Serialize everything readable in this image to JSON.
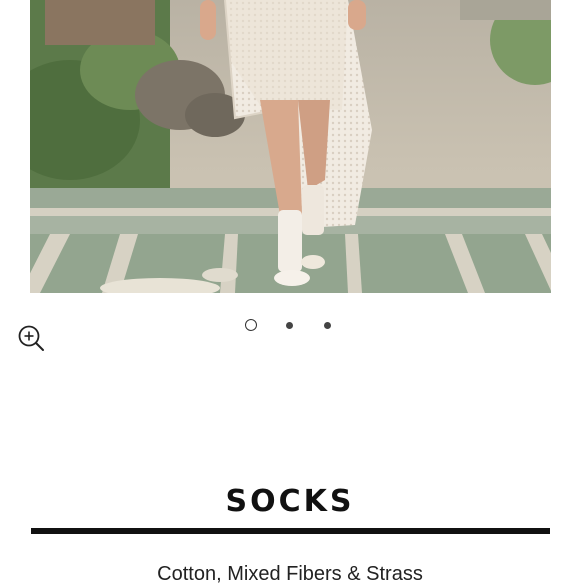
{
  "product": {
    "name": "SOCKS",
    "material": "Cotton, Mixed Fibers & Strass"
  },
  "carousel": {
    "slide_count": 3,
    "active_index": 0
  },
  "icons": {
    "zoom": "zoom-in-icon"
  },
  "colors": {
    "text": "#111111",
    "divider": "#111111",
    "background": "#ffffff"
  }
}
